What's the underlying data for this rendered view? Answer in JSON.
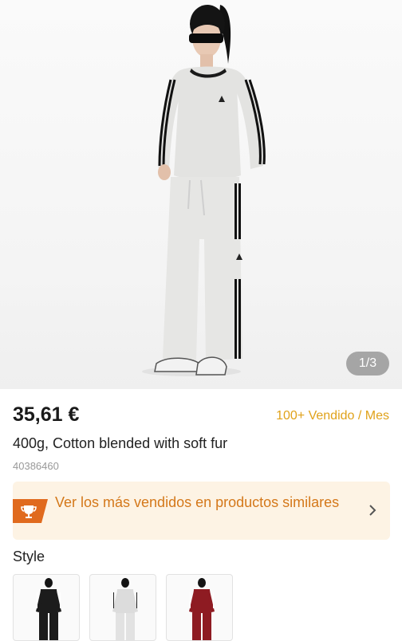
{
  "gallery": {
    "image_alt": "Model wearing a grey crewneck sweatshirt and wide-leg track pants",
    "counter": "1/3"
  },
  "product": {
    "price": "35,61 €",
    "sold": "100+ Vendido / Mes",
    "title": "400g, Cotton blended with soft fur",
    "sku": "40386460"
  },
  "banner": {
    "text": "Ver los más vendidos en productos similares",
    "badge_icon": "trophy-icon",
    "arrow_icon": "chevron-right-icon"
  },
  "style": {
    "label": "Style",
    "options": [
      {
        "name": "black",
        "color": "#1c1c1c"
      },
      {
        "name": "grey",
        "color": "#dcdcdc"
      },
      {
        "name": "burgundy",
        "color": "#8e1b22"
      }
    ]
  },
  "colors": {
    "accent_orange": "#e06a1e",
    "sold_gold": "#e0a21a",
    "banner_bg": "#fdf3e4"
  }
}
